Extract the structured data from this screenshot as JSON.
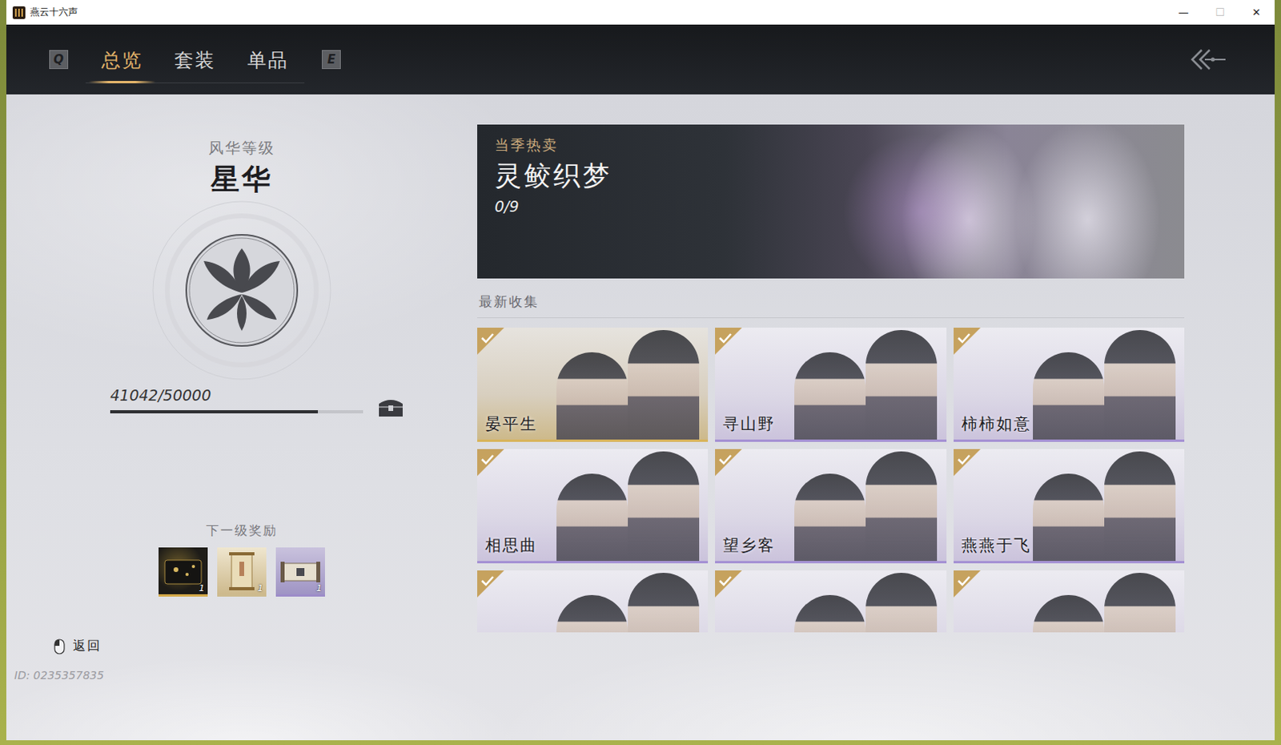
{
  "window": {
    "title": "燕云十六声",
    "controls": [
      "—",
      "☐",
      "✕"
    ]
  },
  "nav": {
    "keys": [
      "Q",
      "E"
    ],
    "tabs": [
      {
        "label": "总览",
        "selected": true
      },
      {
        "label": "套装",
        "selected": false
      },
      {
        "label": "单品",
        "selected": false
      }
    ]
  },
  "level": {
    "caption": "风华等级",
    "name": "星华",
    "progress": "41042/50000",
    "level": 0.82
  },
  "rewards": {
    "title": "下一级奖励",
    "items": [
      {
        "count": "1",
        "color": "#d4a94a"
      },
      {
        "count": "1",
        "color": "#cdbb8f"
      },
      {
        "count": "1",
        "color": "#9d8cc9"
      }
    ]
  },
  "back": {
    "label": "返回"
  },
  "id": "ID: 0235357835",
  "banner": {
    "tag": "当季热卖",
    "title": "灵鲛织梦",
    "count": "0/9"
  },
  "collection": {
    "title": "最新收集",
    "cards": [
      {
        "name": "晏平生",
        "collected": true,
        "color": "#d8b45c"
      },
      {
        "name": "寻山野",
        "collected": true,
        "color": "#a592d4"
      },
      {
        "name": "柿柿如意",
        "collected": true,
        "color": "#a592d4"
      },
      {
        "name": "相思曲",
        "collected": true,
        "color": "#a592d4"
      },
      {
        "name": "望乡客",
        "collected": true,
        "color": "#a592d4"
      },
      {
        "name": "燕燕于飞",
        "collected": true,
        "color": "#a592d4"
      },
      {
        "collected": true,
        "color": "#a592d4"
      },
      {
        "collected": true,
        "color": "#a592d4"
      },
      {
        "collected": true,
        "color": "#a592d4"
      }
    ]
  }
}
